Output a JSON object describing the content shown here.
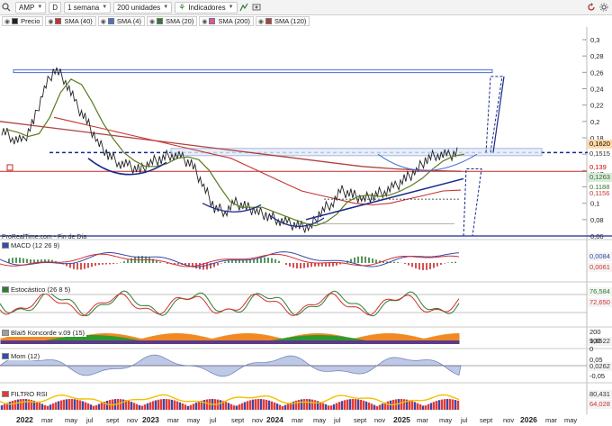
{
  "toolbar": {
    "ticker": "AMP",
    "period_letter": "D",
    "timeframe": "1 semana",
    "units": "200 unidades",
    "indicators": "Indicadores"
  },
  "legend": [
    {
      "label": "Precio",
      "color": "#222222"
    },
    {
      "label": "SMA (40)",
      "color": "#c83232"
    },
    {
      "label": "SMA (4)",
      "color": "#4a6fd1"
    },
    {
      "label": "SMA (20)",
      "color": "#2e7d32"
    },
    {
      "label": "SMA (200)",
      "color": "#e0519f"
    },
    {
      "label": "SMA (120)",
      "color": "#b04040"
    }
  ],
  "price_axis": [
    "0,3",
    "0,28",
    "0,26",
    "0,24",
    "0,22",
    "0,2",
    "0,18",
    "0,16",
    "0,14",
    "0,12",
    "0,1",
    "0,08",
    "0,06"
  ],
  "price_tags": [
    {
      "text": "0,1620",
      "bg": "#ffd9a8",
      "fg": "#000000"
    },
    {
      "text": "0,1515",
      "bg": "#ffffff",
      "fg": "#333333"
    },
    {
      "text": "0,139",
      "bg": "#ffffff",
      "fg": "#cc0000"
    },
    {
      "text": "0,1263",
      "bg": "#d8ecd8",
      "fg": "#336633"
    },
    {
      "text": "0,1188",
      "bg": "#ffffff",
      "fg": "#2e7d32"
    },
    {
      "text": "0,1156",
      "bg": "#ffffff",
      "fg": "#c83232"
    }
  ],
  "source_note": "ProRealTime.com - Fin de Día",
  "panels": [
    {
      "label": "MACD (12 26 9)",
      "tags": [
        "0,0084",
        "0,0061"
      ],
      "tag_colors": [
        "#3949ab",
        "#d32f2f"
      ],
      "axis": []
    },
    {
      "label": "Estocástico (26 8 5)",
      "tags": [
        "76,584",
        "72,650"
      ],
      "tag_colors": [
        "#2e7d32",
        "#d32f2f"
      ],
      "axis": []
    },
    {
      "label": "Blai5 Koncorde v.09 (15)",
      "tags": [
        "9,8522"
      ],
      "tag_colors": [
        "#333333"
      ],
      "axis": [
        "200",
        "100",
        "0"
      ]
    },
    {
      "label": "Mom (12)",
      "tags": [
        "0,0262"
      ],
      "tag_colors": [
        "#333333"
      ],
      "axis": [
        "0,05",
        "-0,05"
      ]
    },
    {
      "label": "FILTRO RSI",
      "tags": [
        "80,431",
        "64,028"
      ],
      "tag_colors": [
        "#333333",
        "#d32f2f"
      ],
      "axis": []
    }
  ],
  "x_axis": [
    {
      "label": "2022",
      "year": true
    },
    {
      "label": "mar",
      "year": false
    },
    {
      "label": "may",
      "year": false
    },
    {
      "label": "jul",
      "year": false
    },
    {
      "label": "sept",
      "year": false
    },
    {
      "label": "nov",
      "year": false
    },
    {
      "label": "2023",
      "year": true
    },
    {
      "label": "mar",
      "year": false
    },
    {
      "label": "may",
      "year": false
    },
    {
      "label": "jul",
      "year": false
    },
    {
      "label": "sept",
      "year": false
    },
    {
      "label": "nov",
      "year": false
    },
    {
      "label": "2024",
      "year": true
    },
    {
      "label": "mar",
      "year": false
    },
    {
      "label": "may",
      "year": false
    },
    {
      "label": "jul",
      "year": false
    },
    {
      "label": "sept",
      "year": false
    },
    {
      "label": "nov",
      "year": false
    },
    {
      "label": "2025",
      "year": true
    },
    {
      "label": "mar",
      "year": false
    },
    {
      "label": "may",
      "year": false
    },
    {
      "label": "jul",
      "year": false
    },
    {
      "label": "sept",
      "year": false
    },
    {
      "label": "nov",
      "year": false
    },
    {
      "label": "2026",
      "year": true
    },
    {
      "label": "mar",
      "year": false
    },
    {
      "label": "may",
      "year": false
    }
  ],
  "chart_data": {
    "type": "line",
    "ylim": [
      0.06,
      0.3
    ],
    "x_start": "2022-01",
    "series": [
      {
        "name": "Precio",
        "values": [
          0.19,
          0.18,
          0.175,
          0.2,
          0.24,
          0.265,
          0.25,
          0.22,
          0.2,
          0.175,
          0.16,
          0.15,
          0.145,
          0.14,
          0.15,
          0.155,
          0.16,
          0.155,
          0.145,
          0.12,
          0.095,
          0.09,
          0.1,
          0.095,
          0.09,
          0.085,
          0.08,
          0.075,
          0.072,
          0.07,
          0.09,
          0.1,
          0.115,
          0.11,
          0.105,
          0.11,
          0.115,
          0.12,
          0.13,
          0.14,
          0.155,
          0.16,
          0.158,
          0.162
        ]
      },
      {
        "name": "SMA (40)",
        "values": [
          0.205,
          0.2,
          0.195,
          0.19,
          0.185,
          0.18,
          0.175,
          0.17,
          0.165,
          0.16,
          0.155,
          0.145,
          0.135,
          0.125,
          0.115,
          0.11,
          0.105,
          0.1,
          0.098,
          0.1,
          0.105,
          0.11,
          0.115,
          0.116
        ]
      },
      {
        "name": "SMA (200)",
        "values": [
          0.2,
          0.195,
          0.19,
          0.185,
          0.18,
          0.175,
          0.17,
          0.165,
          0.16,
          0.155,
          0.15,
          0.145,
          0.142,
          0.14,
          0.139
        ]
      }
    ]
  }
}
